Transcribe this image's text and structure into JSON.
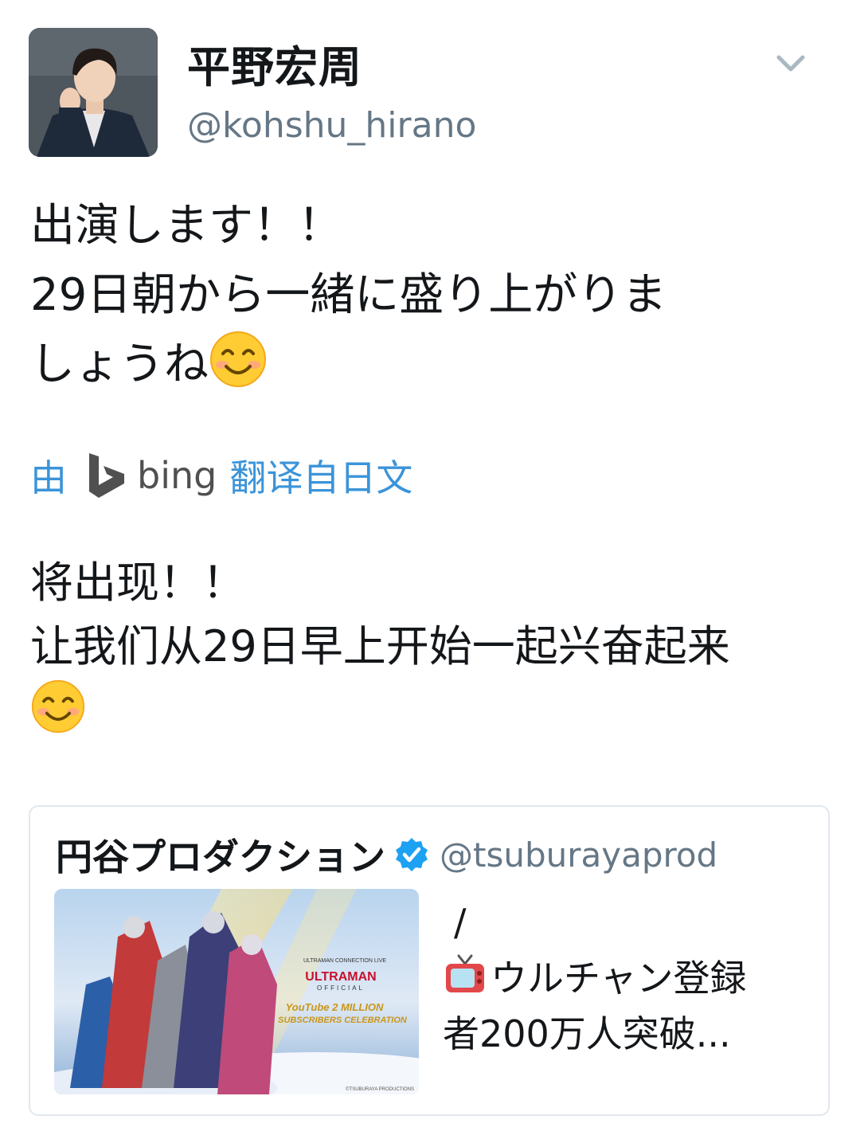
{
  "author": {
    "display_name": "平野宏周",
    "handle": "@kohshu_hirano"
  },
  "tweet": {
    "lines": [
      "出演します！！",
      "29日朝から一緒に盛り上がりま",
      "しょうね"
    ]
  },
  "translation_attribution": {
    "by": "由",
    "engine": "bing",
    "label": "翻译自日文"
  },
  "translation": {
    "lines": [
      "将出现！！",
      "让我们从29日早上开始一起兴奋起来"
    ]
  },
  "quoted_tweet": {
    "name": "円谷プロダクション",
    "handle": "@tsuburayaprod",
    "text_lines": [
      "/",
      "ウルチャン登録",
      "者200万人突破..."
    ],
    "image": {
      "text_top": "ULTRAMAN CONNECTION LIVE",
      "text_brand": "ULTRAMAN",
      "text_official": "OFFICIAL",
      "text_celebration_1": "YouTube 2 MILLION",
      "text_celebration_2": "SUBSCRIBERS CELEBRATION",
      "copyright": "©TSUBURAYA PRODUCTIONS"
    }
  },
  "icons": {
    "chevron": "chevron-down-icon",
    "emoji": "smiling-face-emoji",
    "bing": "bing-logo",
    "verified": "verified-badge-icon",
    "tv": "television-emoji"
  },
  "colors": {
    "link_blue": "#1da1f2",
    "secondary_text": "#657786",
    "verified_blue": "#1da1f2",
    "border": "#e1e8ed"
  }
}
